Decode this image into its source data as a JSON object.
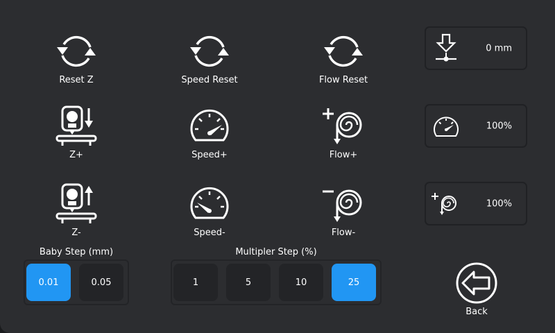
{
  "actions": {
    "reset_z": "Reset Z",
    "speed_reset": "Speed Reset",
    "flow_reset": "Flow Reset",
    "z_plus": "Z+",
    "speed_plus": "Speed+",
    "flow_plus": "Flow+",
    "z_minus": "Z-",
    "speed_minus": "Speed-",
    "flow_minus": "Flow-"
  },
  "status": {
    "z_offset": "0 mm",
    "speed": "100%",
    "flow": "100%"
  },
  "baby_step": {
    "title": "Baby Step (mm)",
    "options": [
      "0.01",
      "0.05"
    ],
    "selected": "0.01"
  },
  "multiplier_step": {
    "title": "Multipler Step (%)",
    "options": [
      "1",
      "5",
      "10",
      "25"
    ],
    "selected": "25"
  },
  "back": {
    "label": "Back"
  },
  "colors": {
    "accent": "#2196f3",
    "background": "#2c2d30",
    "button": "#232427"
  },
  "icons": {
    "reset": "refresh-icon",
    "z_move": "printhead-z-icon",
    "speed": "speedometer-icon",
    "flow": "extruder-flow-icon",
    "z_offset": "z-offset-icon",
    "back": "back-arrow-icon"
  }
}
